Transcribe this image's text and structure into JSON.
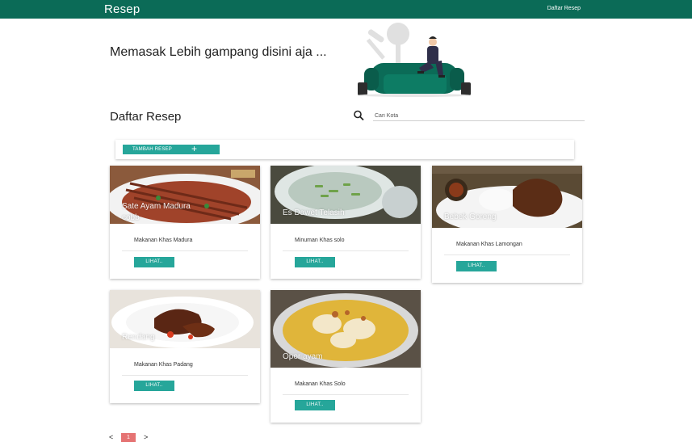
{
  "nav": {
    "brand": "Resep",
    "link": "Daftar Resep"
  },
  "hero": {
    "title": "Memasak Lebih gampang disini aja ..."
  },
  "section": {
    "title": "Daftar Resep"
  },
  "search": {
    "placeholder": "Cari Kota",
    "icon": "search-icon"
  },
  "toolbar": {
    "add_label": "TAMBAH RESEP",
    "add_icon": "plus-icon"
  },
  "cards": [
    {
      "title": "Sate Ayam Madura",
      "subtitle": "cobb",
      "desc": "Makanan Khas Madura",
      "button": "LIHAT.."
    },
    {
      "title": "Es Dawet Telasih",
      "desc": "Minuman Khas solo",
      "button": "LIHAT.."
    },
    {
      "title": "Bebek Goreng",
      "desc": "Makanan Khas Lamongan",
      "button": "LIHAT.."
    },
    {
      "title": "Rendang",
      "desc": "Makanan Khas Padang",
      "button": "LIHAT.."
    },
    {
      "title": "Opor ayam",
      "desc": "Makanan Khas Solo",
      "button": "LIHAT.."
    }
  ],
  "pagination": {
    "prev": "<",
    "current": "1",
    "next": ">"
  },
  "colors": {
    "nav": "#0b6b57",
    "accent": "#26a69a",
    "page_active": "#e57373"
  }
}
